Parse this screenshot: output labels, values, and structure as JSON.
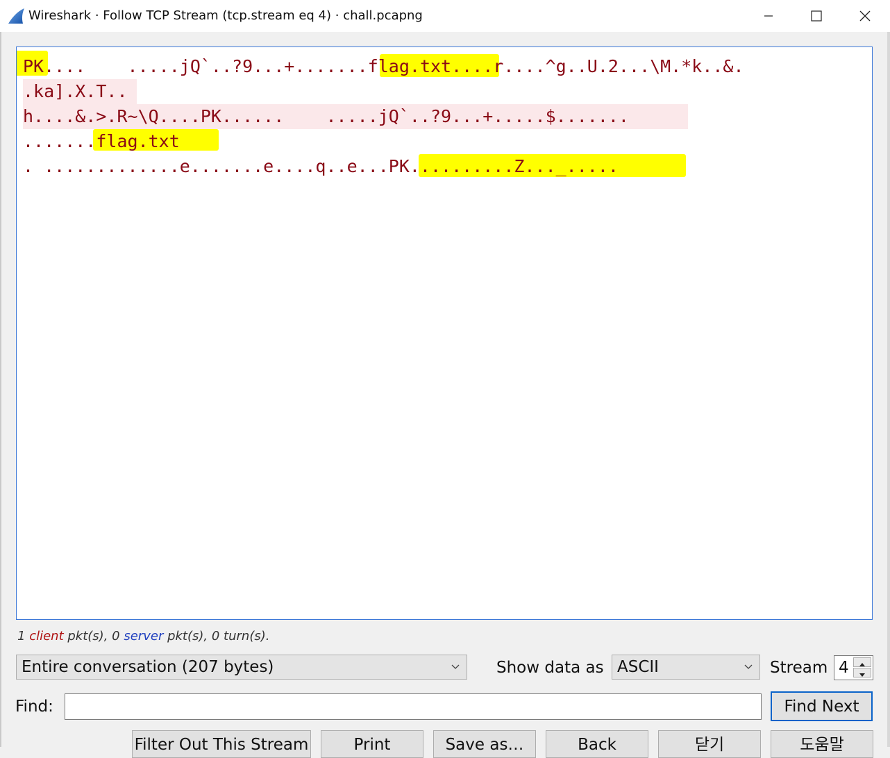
{
  "window": {
    "title": "Wireshark · Follow TCP Stream (tcp.stream eq 4) · chall.pcapng",
    "app_icon": "wireshark-fin-icon",
    "controls": [
      "minimize-icon",
      "maximize-icon",
      "close-icon"
    ]
  },
  "stream_view": {
    "lines": [
      "PK....    .....jQ`..?9...+.......flag.txt....r....^g..U.2...\\M.*k..&.",
      ".ka].X.T..",
      "h....&.>.R~\\Q....PK......    .....jQ`..?9...+.....$.......",
      ".......flag.txt",
      ". .............e.......e....q..e...PK..........Z..._....."
    ],
    "text_color": "#8a0a16",
    "line_background": "#fbe8ea",
    "highlight_color": "#ffff00"
  },
  "status": {
    "client_count": "1",
    "client_word": "client",
    "pkt1": "pkt(s),",
    "server_count": "0",
    "server_word": "server",
    "pkt2": "pkt(s),",
    "turns": "0 turn(s)."
  },
  "controls": {
    "conversation_select": "Entire conversation (207 bytes)",
    "show_data_as_label": "Show data as",
    "format_select": "ASCII",
    "stream_label": "Stream",
    "stream_value": "4",
    "find_label": "Find:",
    "find_value": "",
    "find_next": "Find Next"
  },
  "bottom_buttons": [
    "Filter Out This Stream",
    "Print",
    "Save as…",
    "Back",
    "닫기",
    "도움말"
  ]
}
